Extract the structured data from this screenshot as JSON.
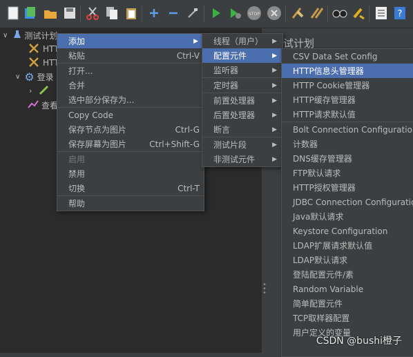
{
  "tree": {
    "root_label": "测试计划",
    "items": [
      {
        "label": "HTT"
      },
      {
        "label": "HTT"
      },
      {
        "label": "登录"
      },
      {
        "label": ""
      },
      {
        "label": "查看"
      }
    ]
  },
  "right_pane": {
    "title": "试计划"
  },
  "context_menu": {
    "items": [
      {
        "label": "添加",
        "shortcut": "",
        "submenu": true
      },
      {
        "label": "粘贴",
        "shortcut": "Ctrl-V"
      },
      {
        "label": "打开..."
      },
      {
        "label": "合并"
      },
      {
        "label": "选中部分保存为..."
      },
      {
        "label": "Copy Code"
      },
      {
        "label": "保存节点为图片",
        "shortcut": "Ctrl-G"
      },
      {
        "label": "保存屏幕为图片",
        "shortcut": "Ctrl+Shift-G"
      },
      {
        "label": "启用"
      },
      {
        "label": "禁用"
      },
      {
        "label": "切换",
        "shortcut": "Ctrl-T"
      },
      {
        "label": "帮助"
      }
    ]
  },
  "add_submenu": {
    "items": [
      {
        "label": "线程（用户）"
      },
      {
        "label": "配置元件"
      },
      {
        "label": "监听器"
      },
      {
        "label": "定时器"
      },
      {
        "label": "前置处理器"
      },
      {
        "label": "后置处理器"
      },
      {
        "label": "断言"
      },
      {
        "label": "测试片段"
      },
      {
        "label": "非测试元件"
      }
    ]
  },
  "config_submenu": {
    "items": [
      {
        "label": "CSV Data Set Config"
      },
      {
        "label": "HTTP信息头管理器"
      },
      {
        "label": "HTTP Cookie管理器"
      },
      {
        "label": "HTTP缓存管理器"
      },
      {
        "label": "HTTP请求默认值"
      },
      {
        "label": "Bolt Connection Configuration"
      },
      {
        "label": "计数器"
      },
      {
        "label": "DNS缓存管理器"
      },
      {
        "label": "FTP默认请求"
      },
      {
        "label": "HTTP授权管理器"
      },
      {
        "label": "JDBC Connection Configuration"
      },
      {
        "label": "Java默认请求"
      },
      {
        "label": "Keystore Configuration"
      },
      {
        "label": "LDAP扩展请求默认值"
      },
      {
        "label": "LDAP默认请求"
      },
      {
        "label": "登陆配置元件/素"
      },
      {
        "label": "Random Variable"
      },
      {
        "label": "简单配置元件"
      },
      {
        "label": "TCP取样器配置"
      },
      {
        "label": "用户定义的变量"
      }
    ]
  },
  "watermark": "CSDN @bushi橙子",
  "colors": {
    "selection": "#4b6eaf",
    "background": "#3c3f41",
    "tree_bg": "#2b2b2b"
  },
  "toolbar_icons": [
    "new-icon",
    "templates-icon",
    "open-icon",
    "save-icon",
    "cut-icon",
    "copy-icon",
    "paste-icon",
    "expand-icon",
    "collapse-icon",
    "toggle-icon",
    "start-icon",
    "start-no-pause-icon",
    "stop-icon",
    "shutdown-icon",
    "clear-icon",
    "clear-all-icon",
    "search-icon",
    "reset-search-icon",
    "function-helper-icon",
    "help-icon"
  ]
}
